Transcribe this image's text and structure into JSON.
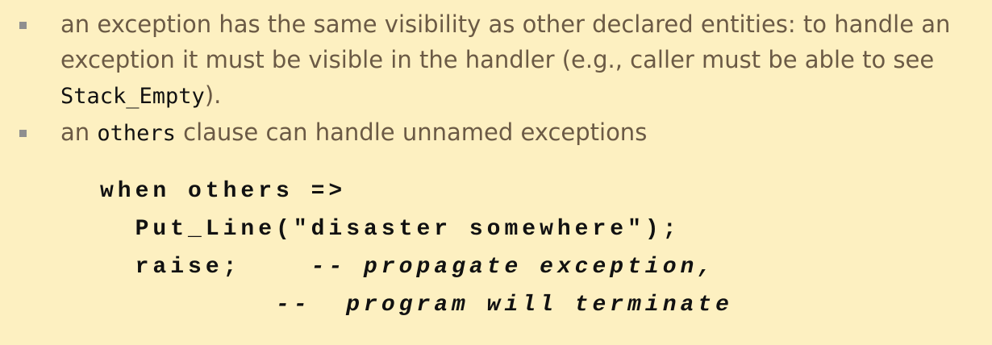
{
  "bullets": [
    {
      "text_before": "an exception has the same visibility as other declared entities: to handle an exception it must be visible in the handler (e.g., caller must be able to see ",
      "code": "Stack_Empty",
      "text_after": ")."
    },
    {
      "text_before": "an ",
      "code": "others",
      "text_after": " clause can handle unnamed exceptions"
    }
  ],
  "code_block": {
    "line1": "when others =>",
    "line2": "  Put_Line(\"disaster somewhere\");",
    "line3_code": "  raise;    ",
    "line3_comment": "-- propagate exception,",
    "line4_indent": "          ",
    "line4_comment": "--  program will terminate"
  }
}
